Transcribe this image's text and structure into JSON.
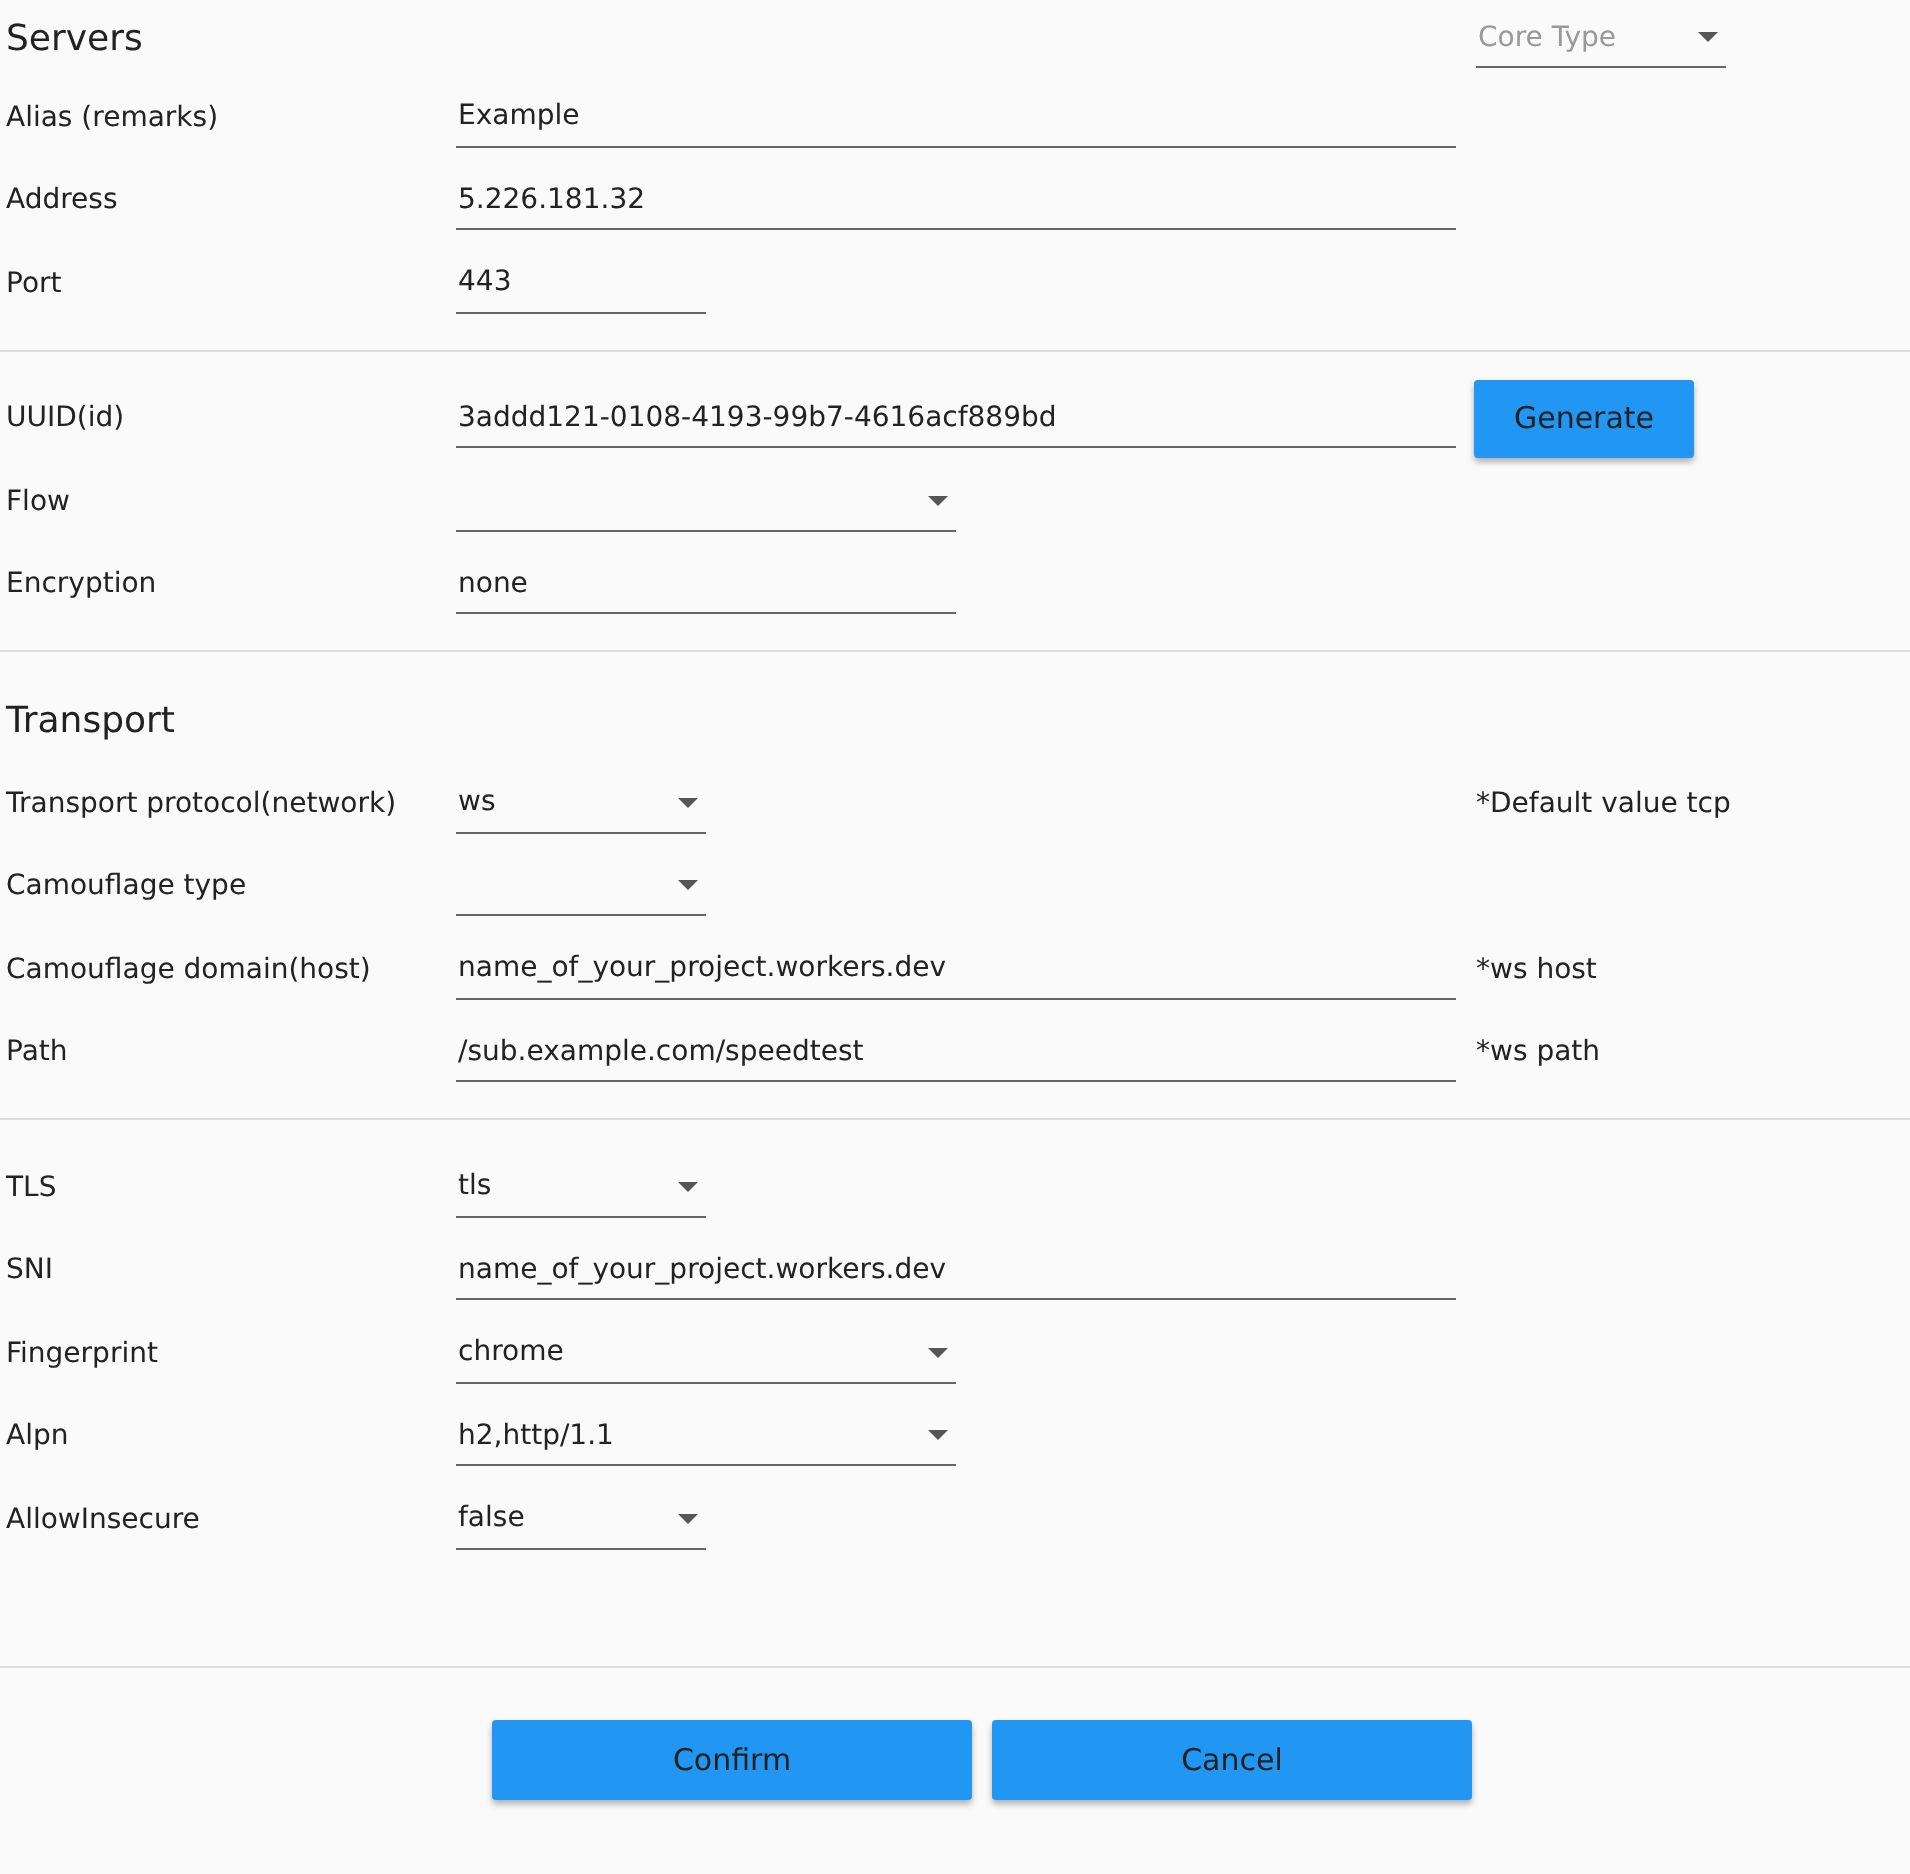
{
  "sections": [
    {
      "title": "Servers",
      "side": {
        "kind": "select",
        "placeholder": "Core Type"
      },
      "rows": [
        {
          "label": "Alias (remarks)",
          "field": {
            "kind": "text",
            "value": "Example"
          }
        },
        {
          "label": "Address",
          "field": {
            "kind": "text",
            "value": "5.226.181.32"
          }
        },
        {
          "label": "Port",
          "field": {
            "kind": "text",
            "value": "443"
          }
        }
      ]
    },
    {
      "rows": [
        {
          "label": "UUID(id)",
          "field": {
            "kind": "text",
            "value": "3addd121-0108-4193-99b7-4616acf889bd"
          },
          "button": "Generate"
        },
        {
          "label": "Flow",
          "field": {
            "kind": "select"
          }
        },
        {
          "label": "Encryption",
          "field": {
            "kind": "text",
            "value": "none"
          }
        }
      ]
    },
    {
      "title": "Transport",
      "rows": [
        {
          "label": "Transport protocol(network)",
          "field": {
            "kind": "select",
            "value": "ws"
          },
          "note": "*Default value tcp"
        },
        {
          "label": "Camouflage type",
          "field": {
            "kind": "select"
          }
        },
        {
          "label": "Camouflage domain(host)",
          "field": {
            "kind": "text",
            "value": "name_of_your_project.workers.dev"
          },
          "note": "*ws host"
        },
        {
          "label": "Path",
          "field": {
            "kind": "text",
            "value": "/sub.example.com/speedtest"
          },
          "note": "*ws path"
        }
      ]
    },
    {
      "rows": [
        {
          "label": "TLS",
          "field": {
            "kind": "select",
            "value": "tls"
          }
        },
        {
          "label": "SNI",
          "field": {
            "kind": "text",
            "value": "name_of_your_project.workers.dev"
          }
        },
        {
          "label": "Fingerprint",
          "field": {
            "kind": "select",
            "value": "chrome"
          }
        },
        {
          "label": "Alpn",
          "field": {
            "kind": "select",
            "value": "h2,http/1.1"
          }
        },
        {
          "label": "AllowInsecure",
          "field": {
            "kind": "select",
            "value": "false"
          }
        }
      ]
    }
  ],
  "buttons": [
    "Confirm",
    "Cancel"
  ]
}
